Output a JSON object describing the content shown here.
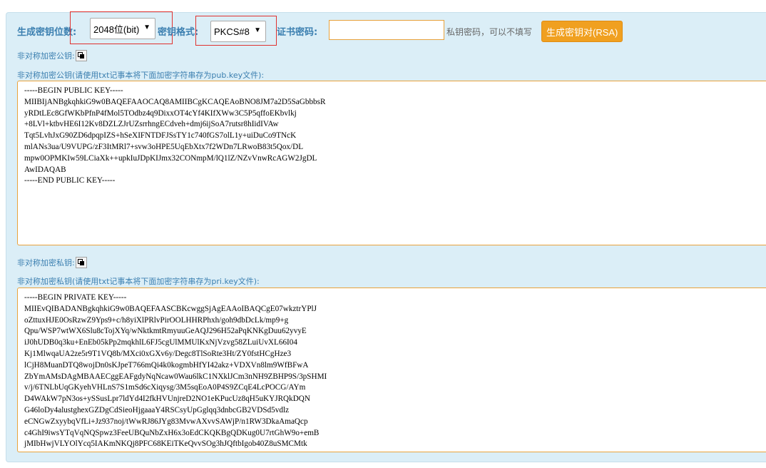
{
  "toolbar": {
    "key_length_label": "生成密钥位数:",
    "key_length_value": "2048位(bit)",
    "key_format_label": "密钥格式:",
    "key_format_value": "PKCS#8",
    "cert_password_label": "证书密码:",
    "cert_password_value": "",
    "cert_password_hint": "私钥密码，可以不填写",
    "generate_button": "生成密钥对(RSA)"
  },
  "public_key": {
    "label": "非对称加密公钥:",
    "instruction": "非对称加密公钥(请使用txt记事本将下面加密字符串存为pub.key文件):",
    "content": "-----BEGIN PUBLIC KEY-----\nMIIBIjANBgkqhkiG9w0BAQEFAAOCAQ8AMIIBCgKCAQEAoBNO8JM7a2D5SaGbbbsR\nyRDtLEc8GfWKbPfnP4fMol5TOdbz4q9DixxOT4cYf4KIfXWw3C5P5qffoEKbvlkj\n+8LVl+ktbvHE6I12Kv8DZLZJrUZsrrhngECdveh+dmj6ijSoA7rutsr8hIidIVAw\nTqt5LvhJxG90ZD6dpqpIZS+hSeXIFNTDFJSsTY1c740fGS7olL1y+uiDuCo9TNcK\nmlANs3ua/U9VUPG/zF3ItMRl7+svw3oHPE5UqEbXtx7f2WDn7LRwoB83t5Qox/DL\nmpw0OPMKIw59LCiaXk++upkIuJDpKIJmx32CONmpM/lQ1lZ/NZvVnwRcAGW2JgDL\nAwIDAQAB\n-----END PUBLIC KEY-----"
  },
  "private_key": {
    "label": "非对称加密私钥:",
    "instruction": "非对称加密私钥(请使用txt记事本将下面加密字符串存为pri.key文件):",
    "content": "-----BEGIN PRIVATE KEY-----\nMIIEvQIBADANBgkqhkiG9w0BAQEFAASCBKcwggSjAgEAAoIBAQCgE07wkztrYPlJ\noZttuxHJE0OsRzwZ9Yps9+c/h8yiXlPRlvPirOOLHHRPhxh/goh9dbDcLk/mp9+g\nQpu/WSP7wtWX6Slu8cTojXYq/wNktkmtRmyuuGeAQJ296H52aPqKNKgDuu62yvyE\niJ0hUDB0q3ku+EnEb05kPp2mqkhlL6FJ5cgUlMMUlKxNjVzvg58ZLuiUvXL66I04\nKj1MlwqaUA2ze5r9T1VQ8b/MXci0xGXv6y/Degc8TlSoRte3Ht/ZY0fstHCgHze3\nlCjH8MuanDTQ8wojDn0sKJpeT766mQi4k0kogmbHfYI42akz+VDXVn8lm9WfBFwA\nZbYmAMsDAgMBAAECggEAFgdyNqNcaw0Wau6lkC1NXklJCm3nNH9ZBHP9S/3pSHMI\nv/j/6TNLbUqGKyehVHLnS7S1mSd6cXiqysg/3M5sqEoA0P4S9ZCqE4LcPOCG/AYm\nD4WAkW7pN3os+ySSusLpr7ldYd4I2fkHVUnjreD2NO1eKPucUz8qH5uKYJRQkDQN\nG46loDy4alustghexGZDgCdSieoHjgaaaY4RSCsyUpGglqq3dnbcGB2VDSd5vdlz\neCNGwZxyybqVfLi+Jz937noj/tWwRJ86JYg83MvwAXvvSAWjP/n1RW3DkaAmaQcp\nc4GhI9iwsYTqVqNQSpwz3FeeUBQuNbZxH6x3oEdCKQKBgQDKug0U7rtGhW9o+emB\njMIbHwjVLYOlYcq5IAKmNKQj8PFC68KEiTKeQvvSOg3hJQftbIgob40Z8uSMCMtk"
  }
}
